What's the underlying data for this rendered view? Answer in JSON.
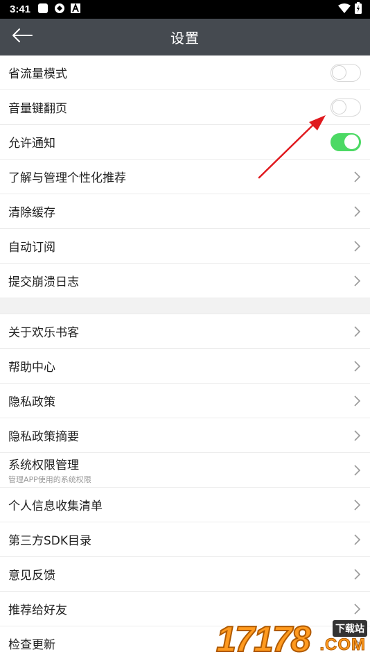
{
  "status_bar": {
    "time": "3:41",
    "icons": [
      "app-square-icon",
      "app-shield-icon",
      "notification-a-icon",
      "wifi-icon",
      "battery-icon"
    ]
  },
  "app_bar": {
    "title": "设置",
    "back_icon": "back-arrow-icon"
  },
  "settings": {
    "toggles": [
      {
        "label": "省流量模式",
        "on": false
      },
      {
        "label": "音量键翻页",
        "on": false
      },
      {
        "label": "允许通知",
        "on": true
      }
    ],
    "group1": [
      {
        "label": "了解与管理个性化推荐"
      },
      {
        "label": "清除缓存"
      },
      {
        "label": "自动订阅"
      },
      {
        "label": "提交崩溃日志"
      }
    ],
    "group2": [
      {
        "label": "关于欢乐书客"
      },
      {
        "label": "帮助中心"
      },
      {
        "label": "隐私政策"
      },
      {
        "label": "隐私政策摘要"
      },
      {
        "label": "系统权限管理",
        "sub": "管理APP使用的系统权限"
      },
      {
        "label": "个人信息收集清单"
      },
      {
        "label": "第三方SDK目录"
      },
      {
        "label": "意见反馈"
      },
      {
        "label": "推荐给好友"
      },
      {
        "label": "检查更新"
      }
    ]
  },
  "colors": {
    "app_bar": "#454a50",
    "toggle_on": "#4cd964",
    "annotation_arrow": "#e0191e"
  },
  "watermark": {
    "number": "17178",
    "badge": "下载站",
    "domain": ".COM"
  }
}
